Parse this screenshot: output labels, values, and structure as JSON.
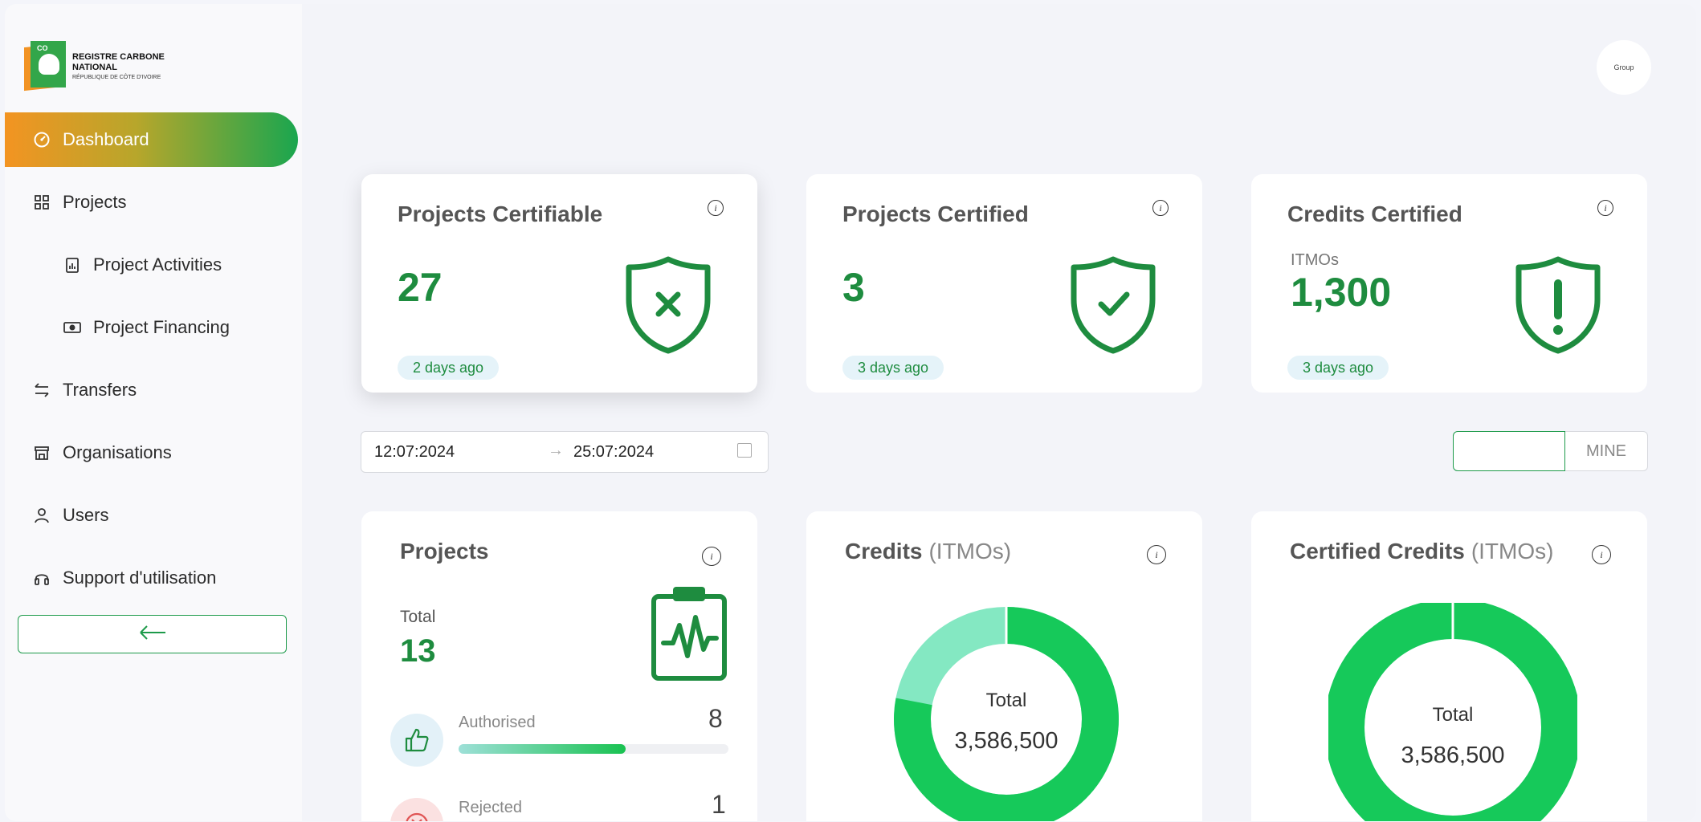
{
  "brand": {
    "title_line1": "REGISTRE CARBONE",
    "title_line2": "NATIONAL",
    "subtitle": "RÉPUBLIQUE DE CÔTE D'IVOIRE",
    "mark": "CO"
  },
  "user": {
    "avatar_text": "Group"
  },
  "nav": [
    {
      "label": "Dashboard",
      "icon": "dashboard-icon",
      "active": true
    },
    {
      "label": "Projects",
      "icon": "grid-icon"
    },
    {
      "label": "Project Activities",
      "icon": "clipboard-chart-icon"
    },
    {
      "label": "Project Financing",
      "icon": "money-icon"
    },
    {
      "label": "Transfers",
      "icon": "transfer-arrows-icon"
    },
    {
      "label": "Organisations",
      "icon": "store-icon"
    },
    {
      "label": "Users",
      "icon": "user-icon"
    },
    {
      "label": "Support d'utilisation",
      "icon": "headset-icon"
    }
  ],
  "stats": [
    {
      "title": "Projects Certifiable",
      "value": "27",
      "sub": "",
      "badge": "2 days ago",
      "icon": "shield-x-icon"
    },
    {
      "title": "Projects Certified",
      "value": "3",
      "sub": "",
      "badge": "3 days ago",
      "icon": "shield-check-icon"
    },
    {
      "title": "Credits Certified",
      "value": "1,300",
      "sub": "ITMOs",
      "badge": "3 days ago",
      "icon": "shield-exclamation-icon"
    }
  ],
  "filters": {
    "date_from": "12:07:2024",
    "date_to": "25:07:2024",
    "toggle_all": "",
    "toggle_mine": "MINE"
  },
  "projects_card": {
    "title": "Projects",
    "total_label": "Total",
    "total": "13",
    "rows": [
      {
        "label": "Authorised",
        "count": "8",
        "progress": 0.62
      },
      {
        "label": "Rejected",
        "count": "1"
      }
    ]
  },
  "credits_card": {
    "title": "Credits",
    "unit": "(ITMOs)",
    "total_label": "Total",
    "total": "3,586,500",
    "share_dark": 0.78
  },
  "certified_card": {
    "title": "Certified Credits",
    "unit": "(ITMOs)",
    "total_label": "Total",
    "total": "3,586,500",
    "share_dark": 1.0
  },
  "colors": {
    "accent_green": "#1e8c3f",
    "donut_dark": "#16c95a",
    "donut_light": "#84e8c2",
    "nav_gradient_start": "#f39422",
    "nav_gradient_end": "#1aa64f"
  }
}
